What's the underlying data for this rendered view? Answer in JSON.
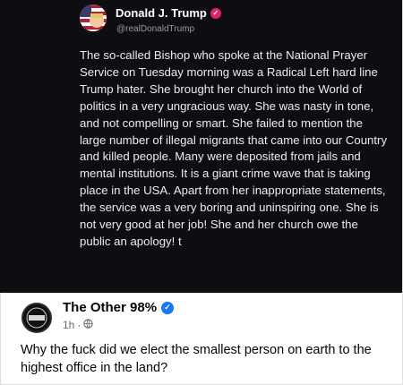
{
  "screenshot": {
    "author_name": "Donald J. Trump",
    "author_handle": "@realDonaldTrump",
    "text": "The so-called Bishop who spoke at the National Prayer Service on Tuesday morning was a Radical Left hard line Trump hater. She brought her church into the World of politics in a very ungracious way. She was nasty in tone, and not compelling or smart. She failed to mention the large number of illegal migrants that came into our Country and killed people. Many were deposited from jails and mental institutions. It is a giant crime wave that is taking place in the USA. Apart from her inappropriate statements, the service was a very boring and uninspiring one. She is not very good at her job! She and her church owe the public an apology! t"
  },
  "post": {
    "page_name": "The Other 98%",
    "avatar_text": "Other 98",
    "time": "1h",
    "separator": "·",
    "text": "Why the fuck did we elect the smallest person on earth to the highest office in the land?"
  },
  "colors": {
    "dark_bg": "#0d0d12",
    "verified_blue": "#1877f2",
    "badge_pink": "#e0245e"
  }
}
